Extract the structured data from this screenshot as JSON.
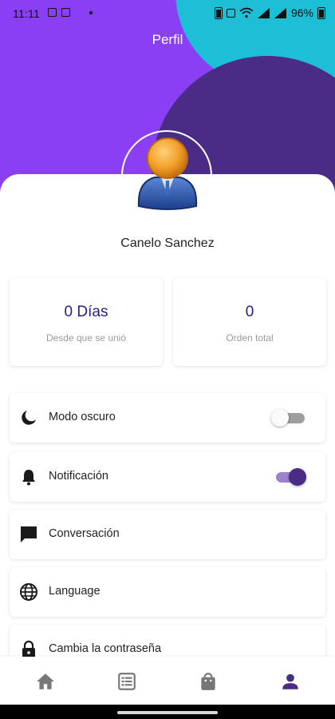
{
  "status_bar": {
    "time": "11:11",
    "battery": "96%"
  },
  "header": {
    "title": "Perfil"
  },
  "profile": {
    "name": "Canelo Sanchez"
  },
  "stats": [
    {
      "value": "0 Días",
      "caption": "Desde que se unió"
    },
    {
      "value": "0",
      "caption": "Orden total"
    }
  ],
  "menu": [
    {
      "label": "Modo oscuro",
      "icon": "moon-icon",
      "toggle": false
    },
    {
      "label": "Notificación",
      "icon": "bell-icon",
      "toggle": true
    },
    {
      "label": "Conversación",
      "icon": "chat-icon"
    },
    {
      "label": "Language",
      "icon": "globe-icon"
    },
    {
      "label": "Cambia la contraseña",
      "icon": "lock-icon"
    }
  ],
  "bottom_nav": [
    {
      "icon": "home-icon",
      "active": false
    },
    {
      "icon": "list-icon",
      "active": false
    },
    {
      "icon": "shopping-bag-icon",
      "active": false
    },
    {
      "icon": "person-icon",
      "active": true
    }
  ],
  "colors": {
    "accent": "#4A2C87",
    "header_purple": "#8B3FF2",
    "header_teal": "#1DBFD6",
    "stat_value": "#2B1B85"
  }
}
